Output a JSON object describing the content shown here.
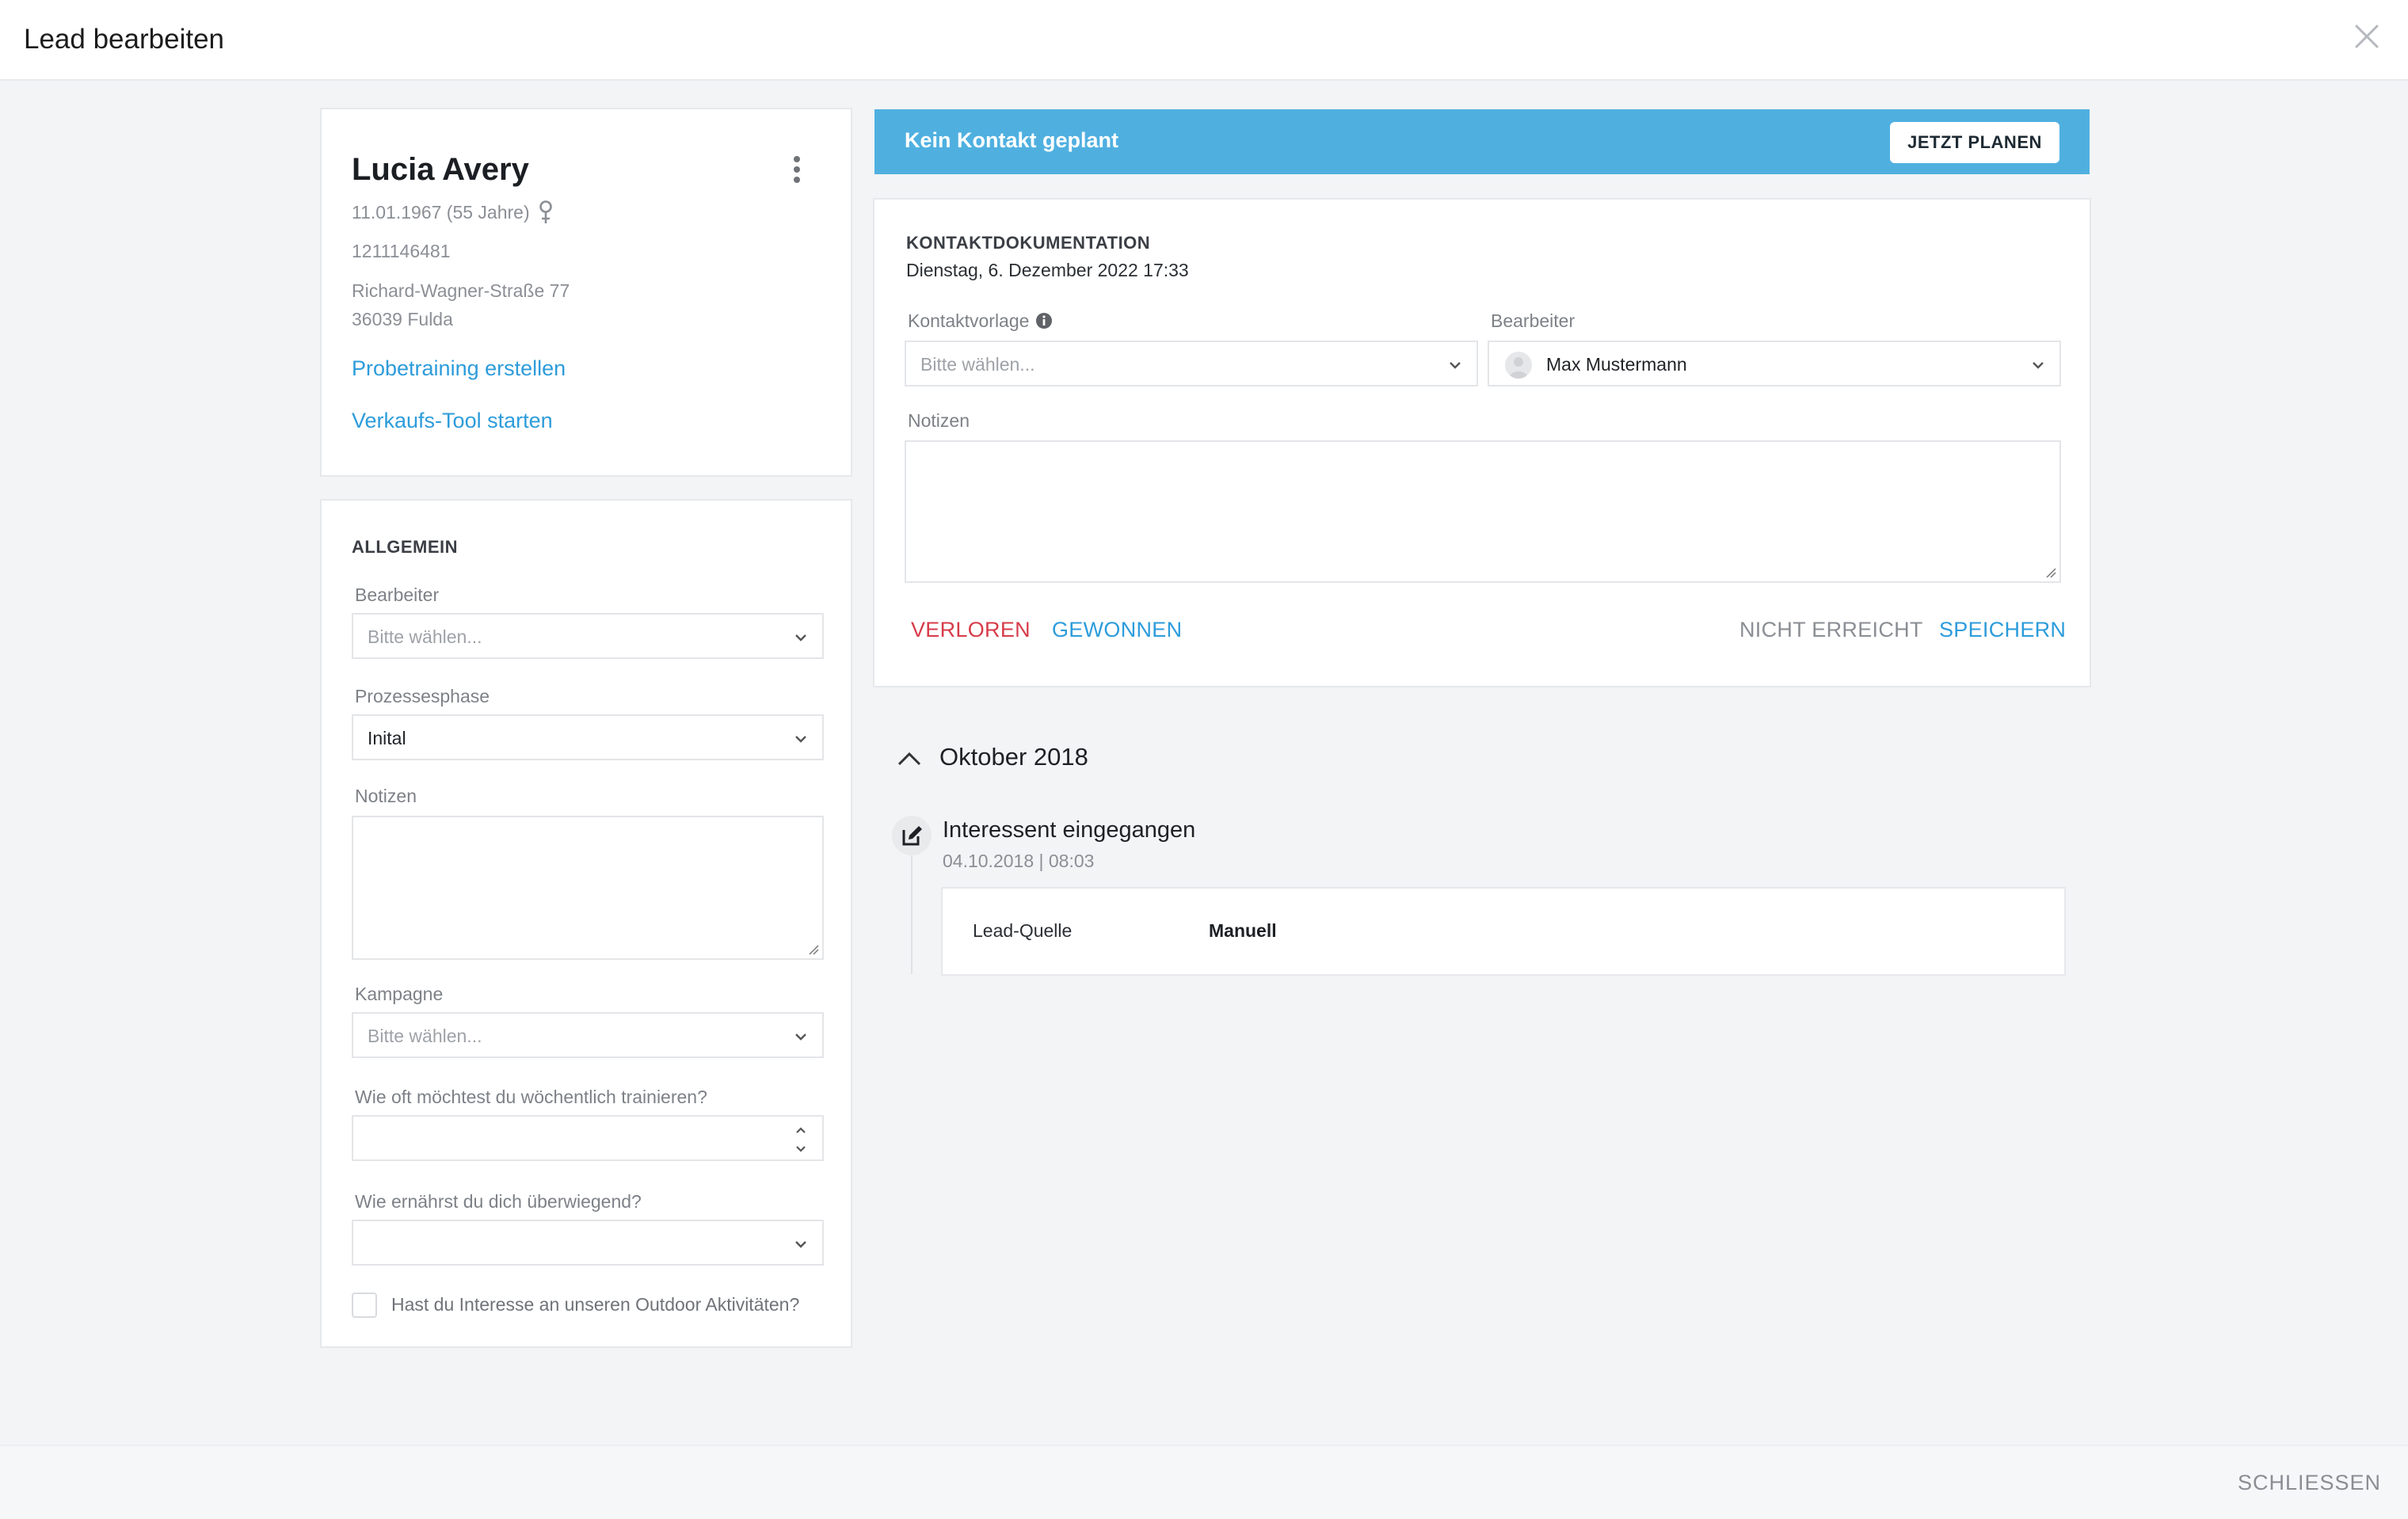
{
  "modal": {
    "title": "Lead bearbeiten",
    "footer_close": "SCHLIESSEN"
  },
  "profile": {
    "name": "Lucia Avery",
    "birth": "11.01.1967 (55 Jahre)",
    "phone": "1211146481",
    "street": "Richard-Wagner-Straße 77",
    "city": "36039 Fulda",
    "link_probetraining": "Probetraining erstellen",
    "link_verkauf": "Verkaufs-Tool starten"
  },
  "general": {
    "title": "ALLGEMEIN",
    "bearbeiter_label": "Bearbeiter",
    "bearbeiter_placeholder": "Bitte wählen...",
    "phase_label": "Prozessesphase",
    "phase_value": "Inital",
    "notes_label": "Notizen",
    "campaign_label": "Kampagne",
    "campaign_placeholder": "Bitte wählen...",
    "q1_label": "Wie oft möchtest du wöchentlich trainieren?",
    "q2_label": "Wie ernährst du dich überwiegend?",
    "q3_label": "Hast du Interesse an unseren Outdoor Aktivitäten?"
  },
  "banner": {
    "text": "Kein Kontakt geplant",
    "button": "JETZT PLANEN"
  },
  "doc": {
    "title": "KONTAKTDOKUMENTATION",
    "date": "Dienstag, 6. Dezember 2022 17:33",
    "template_label": "Kontaktvorlage",
    "template_placeholder": "Bitte wählen...",
    "editor_label": "Bearbeiter",
    "editor_value": "Max Mustermann",
    "notes_label": "Notizen",
    "btn_lost": "VERLOREN",
    "btn_won": "GEWONNEN",
    "btn_not_reached": "NICHT ERREICHT",
    "btn_save": "SPEICHERN"
  },
  "timeline": {
    "month": "Oktober 2018",
    "event_title": "Interessent eingegangen",
    "event_date": "04.10.2018 | 08:03",
    "detail_key": "Lead-Quelle",
    "detail_value": "Manuell"
  },
  "colors": {
    "accent": "#2d9cdb",
    "banner": "#4fb0e0",
    "danger": "#d73c4a",
    "background": "#f3f4f6"
  }
}
